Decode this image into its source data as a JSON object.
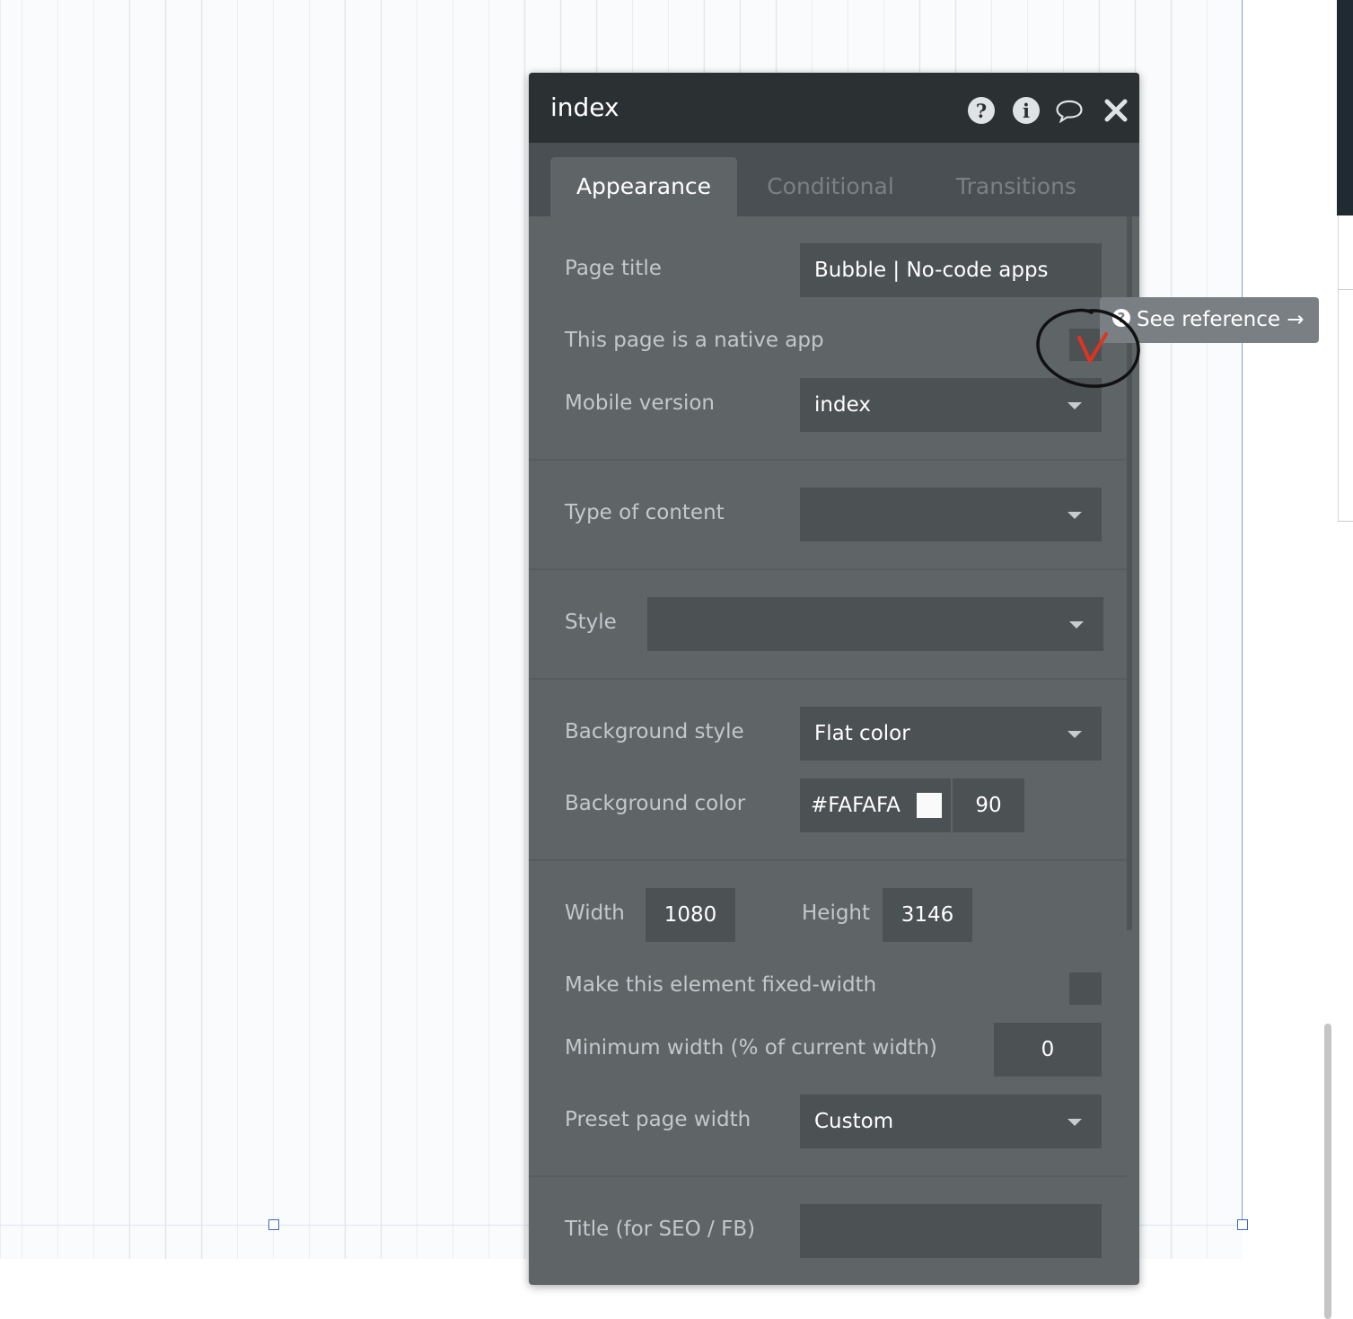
{
  "panel": {
    "title": "index",
    "header_icons": [
      "help-icon",
      "info-icon",
      "comment-icon",
      "close-icon"
    ],
    "help_glyph": "?",
    "info_glyph": "i",
    "tabs": [
      {
        "label": "Appearance",
        "active": true
      },
      {
        "label": "Conditional",
        "active": false
      },
      {
        "label": "Transitions",
        "active": false
      }
    ]
  },
  "fields": {
    "page_title": {
      "label": "Page title",
      "value": "Bubble | No-code apps"
    },
    "native_app": {
      "label": "This page is a native app"
    },
    "mobile_version": {
      "label": "Mobile version",
      "value": "index"
    },
    "type_of_content": {
      "label": "Type of content",
      "value": ""
    },
    "style": {
      "label": "Style",
      "value": ""
    },
    "background_style": {
      "label": "Background style",
      "value": "Flat color"
    },
    "background_color": {
      "label": "Background color",
      "value": "#FAFAFA",
      "opacity": "90",
      "swatch": "#FAFAFA"
    },
    "width": {
      "label": "Width",
      "value": "1080"
    },
    "height": {
      "label": "Height",
      "value": "3146"
    },
    "fixed_width": {
      "label": "Make this element fixed-width"
    },
    "min_width": {
      "label": "Minimum width (% of current width)",
      "value": "0"
    },
    "preset_width": {
      "label": "Preset page width",
      "value": "Custom"
    },
    "seo_title": {
      "label": "Title (for SEO / FB)",
      "value": ""
    }
  },
  "tooltip": {
    "text": "See reference →",
    "glyph": "?"
  },
  "annotation": {
    "mark": "V",
    "ink_color": "#111111",
    "mark_color": "#e0341e"
  },
  "colors": {
    "panel_bg": "#5f6467",
    "header_bg": "#2b3033",
    "field_bg": "#4c5154",
    "canvas_bg": "#fafbfd"
  }
}
